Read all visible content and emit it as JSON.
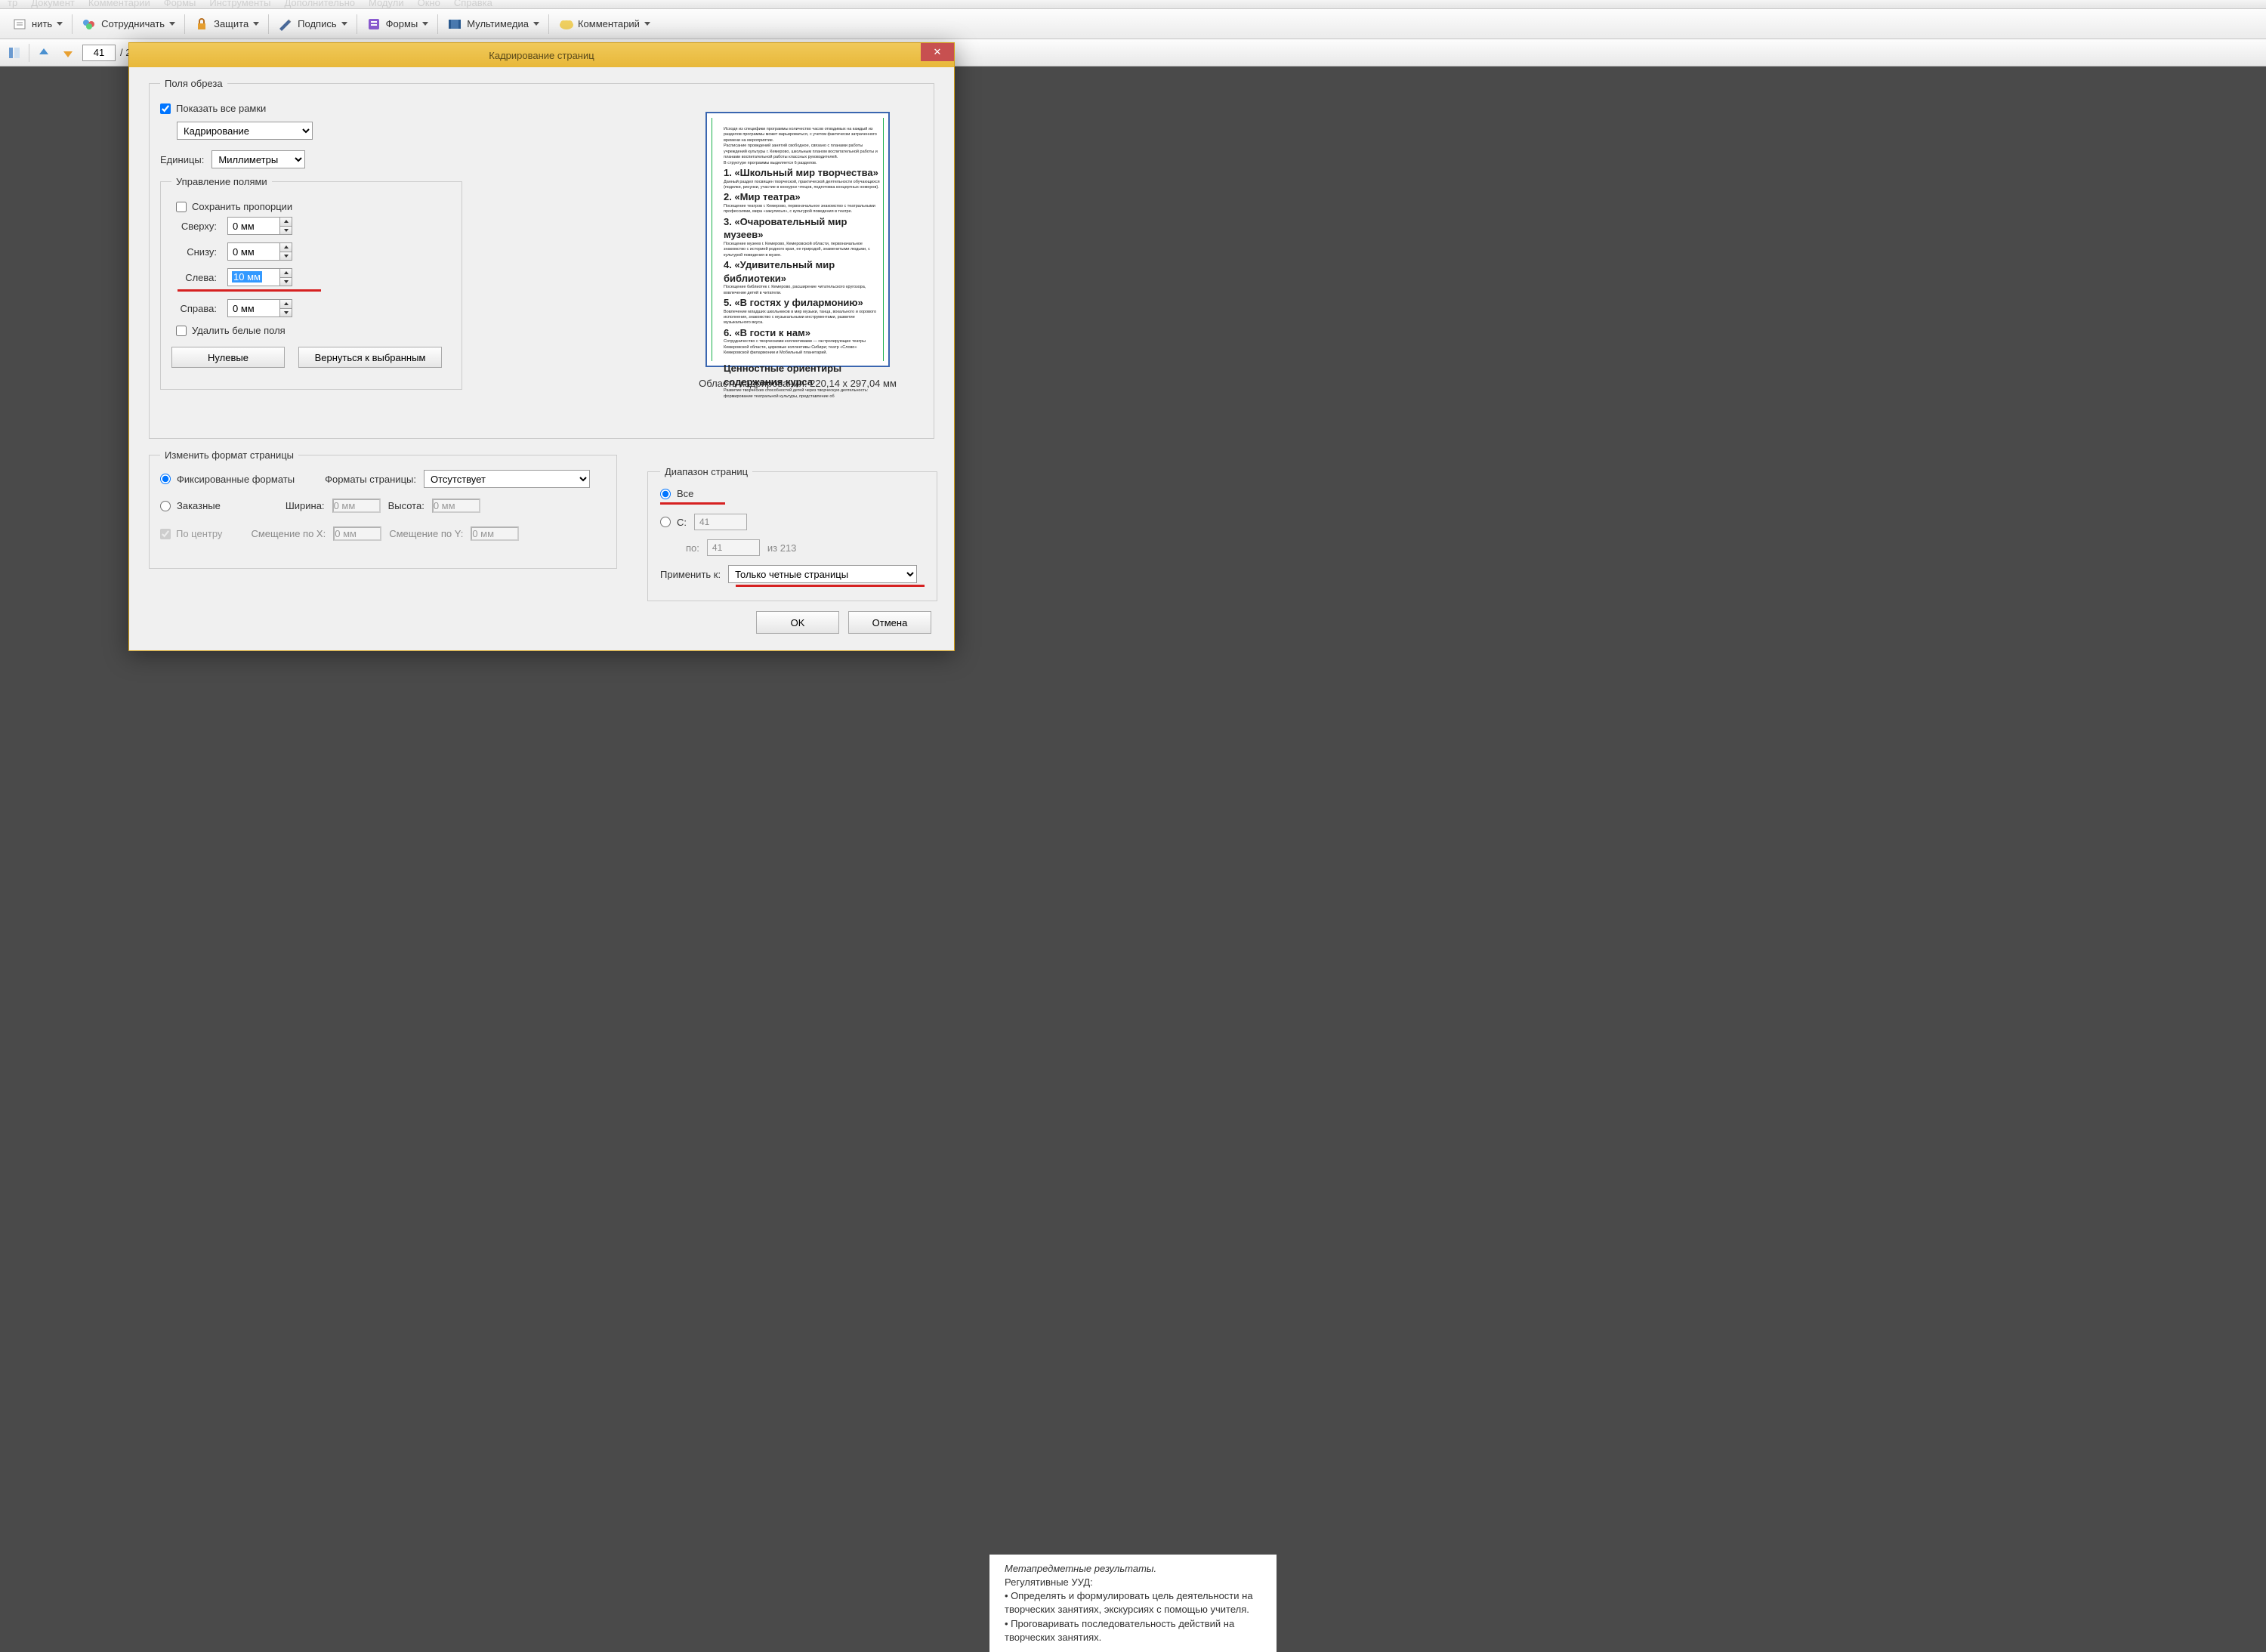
{
  "menubar": [
    "тр",
    "Документ",
    "Комментарии",
    "Формы",
    "Инструменты",
    "Дополнительно",
    "Модули",
    "Окно",
    "Справка"
  ],
  "toolbar": {
    "convert": "нить",
    "collaborate": "Сотрудничать",
    "security": "Защита",
    "sign": "Подпись",
    "forms": "Формы",
    "multimedia": "Мультимедиа",
    "comment": "Комментарий"
  },
  "nav": {
    "page": "41",
    "sep": "/ 2"
  },
  "dialog": {
    "title": "Кадрирование страниц",
    "close": "✕",
    "crop_fields": {
      "legend": "Поля обреза",
      "show_all": "Показать все рамки",
      "crop_select": "Кадрирование",
      "units_label": "Единицы:",
      "units_value": "Миллиметры",
      "margin_legend": "Управление полями",
      "keep_prop": "Сохранить пропорции",
      "top": "Сверху:",
      "top_v": "0 мм",
      "bottom": "Снизу:",
      "bottom_v": "0 мм",
      "left": "Слева:",
      "left_v": "10 мм",
      "right": "Справа:",
      "right_v": "0 мм",
      "remove_white": "Удалить белые поля",
      "zero_btn": "Нулевые",
      "revert_btn": "Вернуться к выбранным"
    },
    "preview_caption": "Область кадрирования: 220,14 x 297,04 мм",
    "page_fmt": {
      "legend": "Изменить формат страницы",
      "fixed": "Фиксированные форматы",
      "custom": "Заказные",
      "center": "По центру",
      "formats_label": "Форматы страницы:",
      "formats_value": "Отсутствует",
      "width": "Ширина:",
      "width_v": "0 мм",
      "height": "Высота:",
      "height_v": "0 мм",
      "offx": "Смещение по X:",
      "offx_v": "0 мм",
      "offy": "Смещение по Y:",
      "offy_v": "0 мм"
    },
    "range": {
      "legend": "Диапазон страниц",
      "all": "Все",
      "from": "С:",
      "from_v": "41",
      "to": "по:",
      "to_v": "41",
      "of": "из 213",
      "apply_label": "Применить к:",
      "apply_value": "Только четные страницы"
    },
    "ok": "OK",
    "cancel": "Отмена"
  },
  "docsnip": {
    "l1": "Метапредметные результаты.",
    "l2": "Регулятивные УУД:",
    "l3": "• Определять и формулировать цель деятельности на творческих занятиях, экскурсиях с помощью учителя.",
    "l4": "• Проговаривать последовательность действий на творческих занятиях."
  }
}
